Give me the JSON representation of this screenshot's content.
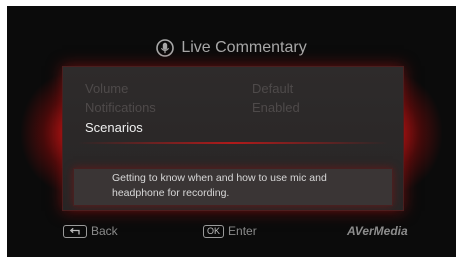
{
  "header": {
    "title": "Live Commentary",
    "icon": "microphone-icon"
  },
  "menu": {
    "items": [
      {
        "label": "Volume",
        "value": "Default"
      },
      {
        "label": "Notifications",
        "value": "Enabled"
      },
      {
        "label": "Scenarios",
        "value": ""
      }
    ],
    "selected": "Scenarios"
  },
  "description": "Getting to know when and how to use mic and headphone for recording.",
  "footer": {
    "back_label": "Back",
    "ok_key": "OK",
    "enter_label": "Enter",
    "brand": "AVerMedia"
  },
  "colors": {
    "accent": "#c81414",
    "background": "#0b0b0b",
    "panel": "#2e2b2b"
  }
}
